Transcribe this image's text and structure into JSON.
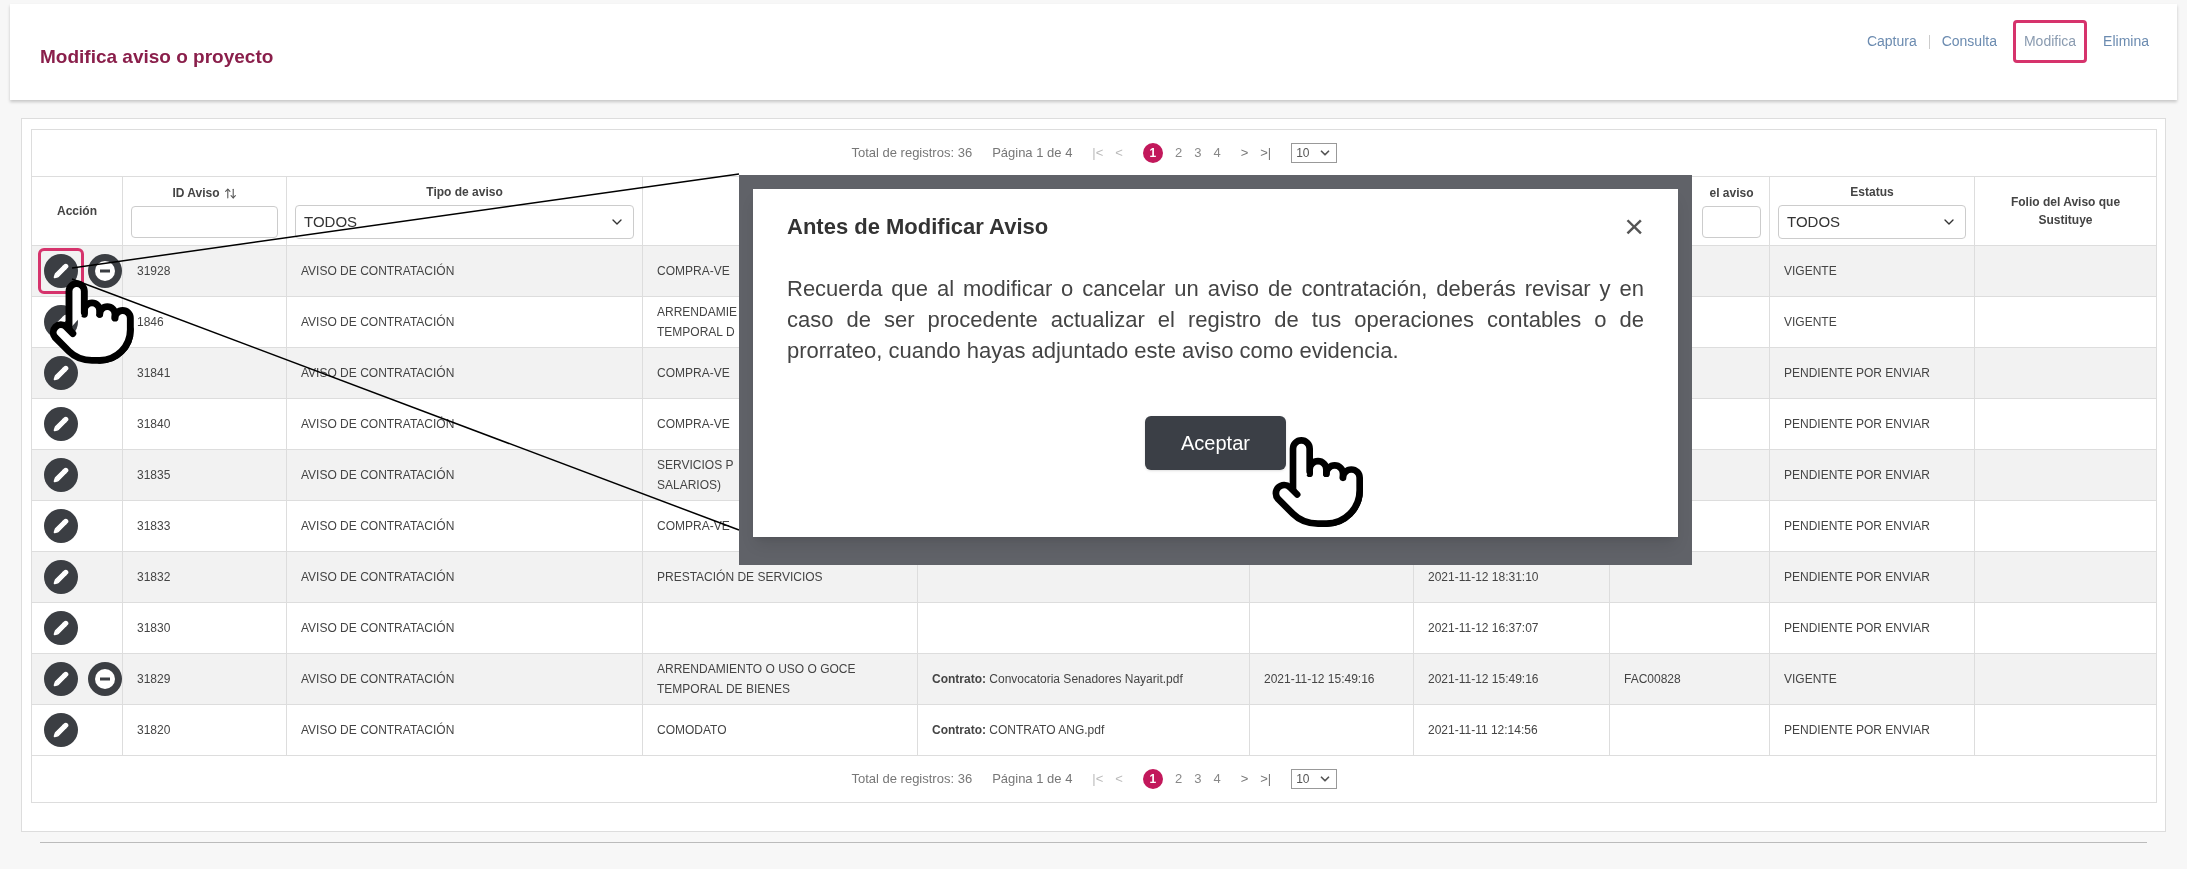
{
  "header": {
    "title": "Modifica aviso o proyecto",
    "nav": [
      {
        "label": "Captura",
        "selected": false
      },
      {
        "label": "Consulta",
        "selected": false
      },
      {
        "label": "Modifica",
        "selected": true
      },
      {
        "label": "Elimina",
        "selected": false
      }
    ]
  },
  "pagination_top": {
    "total": "Total de registros: 36",
    "page_info": "Página 1 de 4",
    "first": "|<",
    "prev": "<",
    "pages": [
      {
        "label": "1",
        "selected": true
      },
      {
        "label": "2",
        "selected": false
      },
      {
        "label": "3",
        "selected": false
      },
      {
        "label": "4",
        "selected": false
      }
    ],
    "next": ">",
    "last": ">|",
    "page_size": "10"
  },
  "columns": [
    {
      "label": "Acción",
      "kind": "plain"
    },
    {
      "label": "ID Aviso",
      "kind": "input",
      "sortable": true
    },
    {
      "label": "Tipo de aviso",
      "kind": "select",
      "value": "TODOS"
    },
    {
      "kind": "plain"
    },
    {
      "kind": "plain"
    },
    {
      "kind": "plain"
    },
    {
      "kind": "plain"
    },
    {
      "label": "el aviso",
      "kind": "input"
    },
    {
      "label": "Estatus",
      "kind": "select",
      "value": "TODOS"
    },
    {
      "label": "Folio del Aviso que Sustituye",
      "kind": "plain"
    }
  ],
  "rows": [
    {
      "highlighted": true,
      "cancel": true,
      "cells": [
        "31928",
        "AVISO DE CONTRATACIÓN",
        "COMPRA-VE",
        "",
        "",
        "",
        "",
        "VIGENTE",
        ""
      ]
    },
    {
      "highlighted": false,
      "cancel": false,
      "cells": [
        "1846",
        "AVISO DE CONTRATACIÓN",
        "ARRENDAMIE\nTEMPORAL D",
        "",
        "",
        "",
        "",
        "VIGENTE",
        ""
      ]
    },
    {
      "highlighted": false,
      "cancel": false,
      "cells": [
        "31841",
        "AVISO DE CONTRATACIÓN",
        "COMPRA-VE",
        "",
        "",
        "",
        "",
        "PENDIENTE POR ENVIAR",
        ""
      ]
    },
    {
      "highlighted": false,
      "cancel": false,
      "cells": [
        "31840",
        "AVISO DE CONTRATACIÓN",
        "COMPRA-VE",
        "",
        "",
        "",
        "",
        "PENDIENTE POR ENVIAR",
        ""
      ]
    },
    {
      "highlighted": false,
      "cancel": false,
      "cells": [
        "31835",
        "AVISO DE CONTRATACIÓN",
        "SERVICIOS P\nSALARIOS)",
        "",
        "",
        "",
        "",
        "PENDIENTE POR ENVIAR",
        ""
      ]
    },
    {
      "highlighted": false,
      "cancel": false,
      "cells": [
        "31833",
        "AVISO DE CONTRATACIÓN",
        "COMPRA-VE",
        "",
        "",
        "",
        "",
        "PENDIENTE POR ENVIAR",
        ""
      ]
    },
    {
      "highlighted": false,
      "cancel": false,
      "cells": [
        "31832",
        "AVISO DE CONTRATACIÓN",
        "PRESTACIÓN DE SERVICIOS",
        "",
        "",
        "2021-11-12 18:31:10",
        "",
        "PENDIENTE POR ENVIAR",
        ""
      ]
    },
    {
      "highlighted": false,
      "cancel": false,
      "cells": [
        "31830",
        "AVISO DE CONTRATACIÓN",
        "",
        "",
        "",
        "2021-11-12 16:37:07",
        "",
        "PENDIENTE POR ENVIAR",
        ""
      ]
    },
    {
      "highlighted": false,
      "cancel": true,
      "cells": [
        "31829",
        "AVISO DE CONTRATACIÓN",
        "ARRENDAMIENTO O USO O GOCE\nTEMPORAL DE BIENES",
        "**Contrato:** Convocatoria Senadores Nayarit.pdf",
        "2021-11-12 15:49:16",
        "2021-11-12 15:49:16",
        "FAC00828",
        "VIGENTE",
        ""
      ]
    },
    {
      "highlighted": false,
      "cancel": false,
      "cells": [
        "31820",
        "AVISO DE CONTRATACIÓN",
        "COMODATO",
        "**Contrato:** CONTRATO ANG.pdf",
        "",
        "2021-11-11 12:14:56",
        "",
        "PENDIENTE POR ENVIAR",
        ""
      ]
    }
  ],
  "pagination_bottom": {
    "total": "Total de registros: 36",
    "page_info": "Página 1 de 4",
    "first": "|<",
    "prev": "<",
    "pages": [
      {
        "label": "1",
        "selected": true
      },
      {
        "label": "2",
        "selected": false
      },
      {
        "label": "3",
        "selected": false
      },
      {
        "label": "4",
        "selected": false
      }
    ],
    "next": ">",
    "last": ">|",
    "page_size": "10"
  },
  "modal": {
    "title": "Antes de Modificar Aviso",
    "close": "×",
    "body": "Recuerda que al modificar o cancelar un aviso de contratación, deberás revisar y en caso de ser procedente actualizar el registro de tus operaciones contables o de prorrateo, cuando hayas adjuntado este aviso como evidencia.",
    "button": "Aceptar"
  }
}
